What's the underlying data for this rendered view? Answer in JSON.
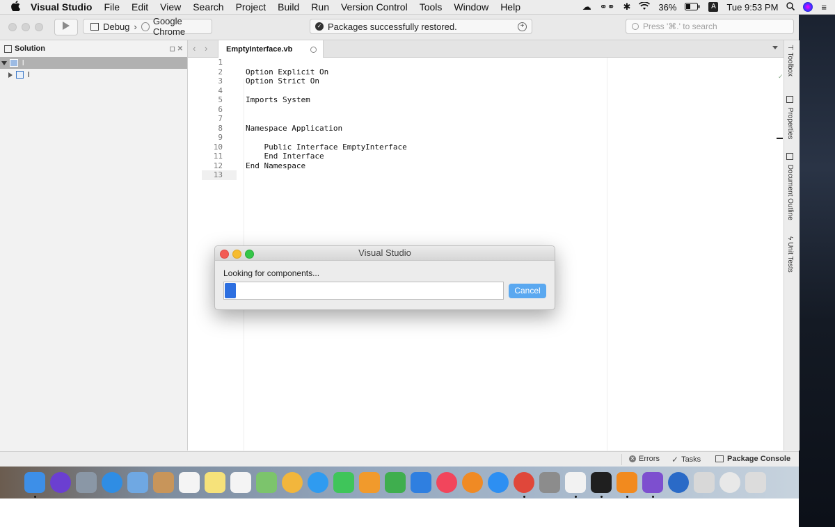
{
  "menubar": {
    "apple": "",
    "app_name": "Visual Studio",
    "items": [
      "File",
      "Edit",
      "View",
      "Search",
      "Project",
      "Build",
      "Run",
      "Version Control",
      "Tools",
      "Window",
      "Help"
    ],
    "battery": "36%",
    "input_source": "A",
    "clock": "Tue 9:53 PM"
  },
  "toolbar": {
    "config": "Debug",
    "target": "Google Chrome",
    "status_text": "Packages successfully restored.",
    "search_placeholder": "Press '⌘.' to search"
  },
  "solution_pad": {
    "title": "Solution",
    "items": [
      {
        "label": "l",
        "selected": true
      },
      {
        "label": "l",
        "selected": false
      }
    ]
  },
  "editor": {
    "tab_label": "EmptyInterface.vb",
    "line_numbers": [
      "1",
      "2",
      "3",
      "4",
      "5",
      "6",
      "7",
      "8",
      "9",
      "10",
      "11",
      "12",
      "13"
    ],
    "code_lines": [
      "",
      "Option Explicit On",
      "Option Strict On",
      "",
      "Imports System",
      "",
      "",
      "Namespace Application",
      "",
      "    Public Interface EmptyInterface",
      "    End Interface",
      "End Namespace",
      ""
    ]
  },
  "right_dock": {
    "items": [
      "Toolbox",
      "Properties",
      "Document Outline",
      "Unit Tests"
    ]
  },
  "bottom_bar": {
    "errors": "Errors",
    "tasks": "Tasks",
    "package_console": "Package Console"
  },
  "dialog": {
    "title": "Visual Studio",
    "message": "Looking for components...",
    "progress_fraction": 0.04,
    "cancel": "Cancel"
  },
  "dock": {
    "apps": [
      {
        "name": "finder-icon",
        "color": "#3d8fe8",
        "running": true
      },
      {
        "name": "siri-icon",
        "color": "#6b3fd1",
        "running": false
      },
      {
        "name": "launchpad-icon",
        "color": "#8a97a6",
        "running": false
      },
      {
        "name": "safari-icon",
        "color": "#2f8de4",
        "running": false
      },
      {
        "name": "mail-icon",
        "color": "#6fa8e3",
        "running": false
      },
      {
        "name": "contacts-icon",
        "color": "#c8955a",
        "running": false
      },
      {
        "name": "calendar-icon",
        "color": "#f4f4f4",
        "running": false
      },
      {
        "name": "notes-icon",
        "color": "#f6e27a",
        "running": false
      },
      {
        "name": "reminders-icon",
        "color": "#f4f4f4",
        "running": false
      },
      {
        "name": "maps-icon",
        "color": "#7cc46c",
        "running": false
      },
      {
        "name": "photos-icon",
        "color": "#f2b63c",
        "running": false
      },
      {
        "name": "messages-icon",
        "color": "#2f9bf0",
        "running": false
      },
      {
        "name": "facetime-icon",
        "color": "#3fc55a",
        "running": false
      },
      {
        "name": "pages-icon",
        "color": "#f19a2c",
        "running": false
      },
      {
        "name": "numbers-icon",
        "color": "#3fae4e",
        "running": false
      },
      {
        "name": "keynote-icon",
        "color": "#2f7fe0",
        "running": false
      },
      {
        "name": "music-icon",
        "color": "#f2455c",
        "running": false
      },
      {
        "name": "books-icon",
        "color": "#f08a24",
        "running": false
      },
      {
        "name": "app-store-icon",
        "color": "#2d8ff2",
        "running": false
      },
      {
        "name": "chrome-icon",
        "color": "#e0473a",
        "running": true
      },
      {
        "name": "system-preferences-icon",
        "color": "#8c8c8c",
        "running": false
      },
      {
        "name": "unity-icon",
        "color": "#f2f2f2",
        "running": true
      },
      {
        "name": "terminal-icon",
        "color": "#1f1f1f",
        "running": true
      },
      {
        "name": "sublime-text-icon",
        "color": "#f28a1e",
        "running": true
      },
      {
        "name": "visual-studio-icon",
        "color": "#7d4fcf",
        "running": true
      },
      {
        "name": "1password-icon",
        "color": "#2a6ac7",
        "running": false
      },
      {
        "name": "archive-utility-icon",
        "color": "#d8d8d8",
        "running": false
      },
      {
        "name": "chrome-window-icon",
        "color": "#e8e8e8",
        "running": false
      },
      {
        "name": "trash-icon",
        "color": "#dcdcdc",
        "running": false
      }
    ]
  }
}
